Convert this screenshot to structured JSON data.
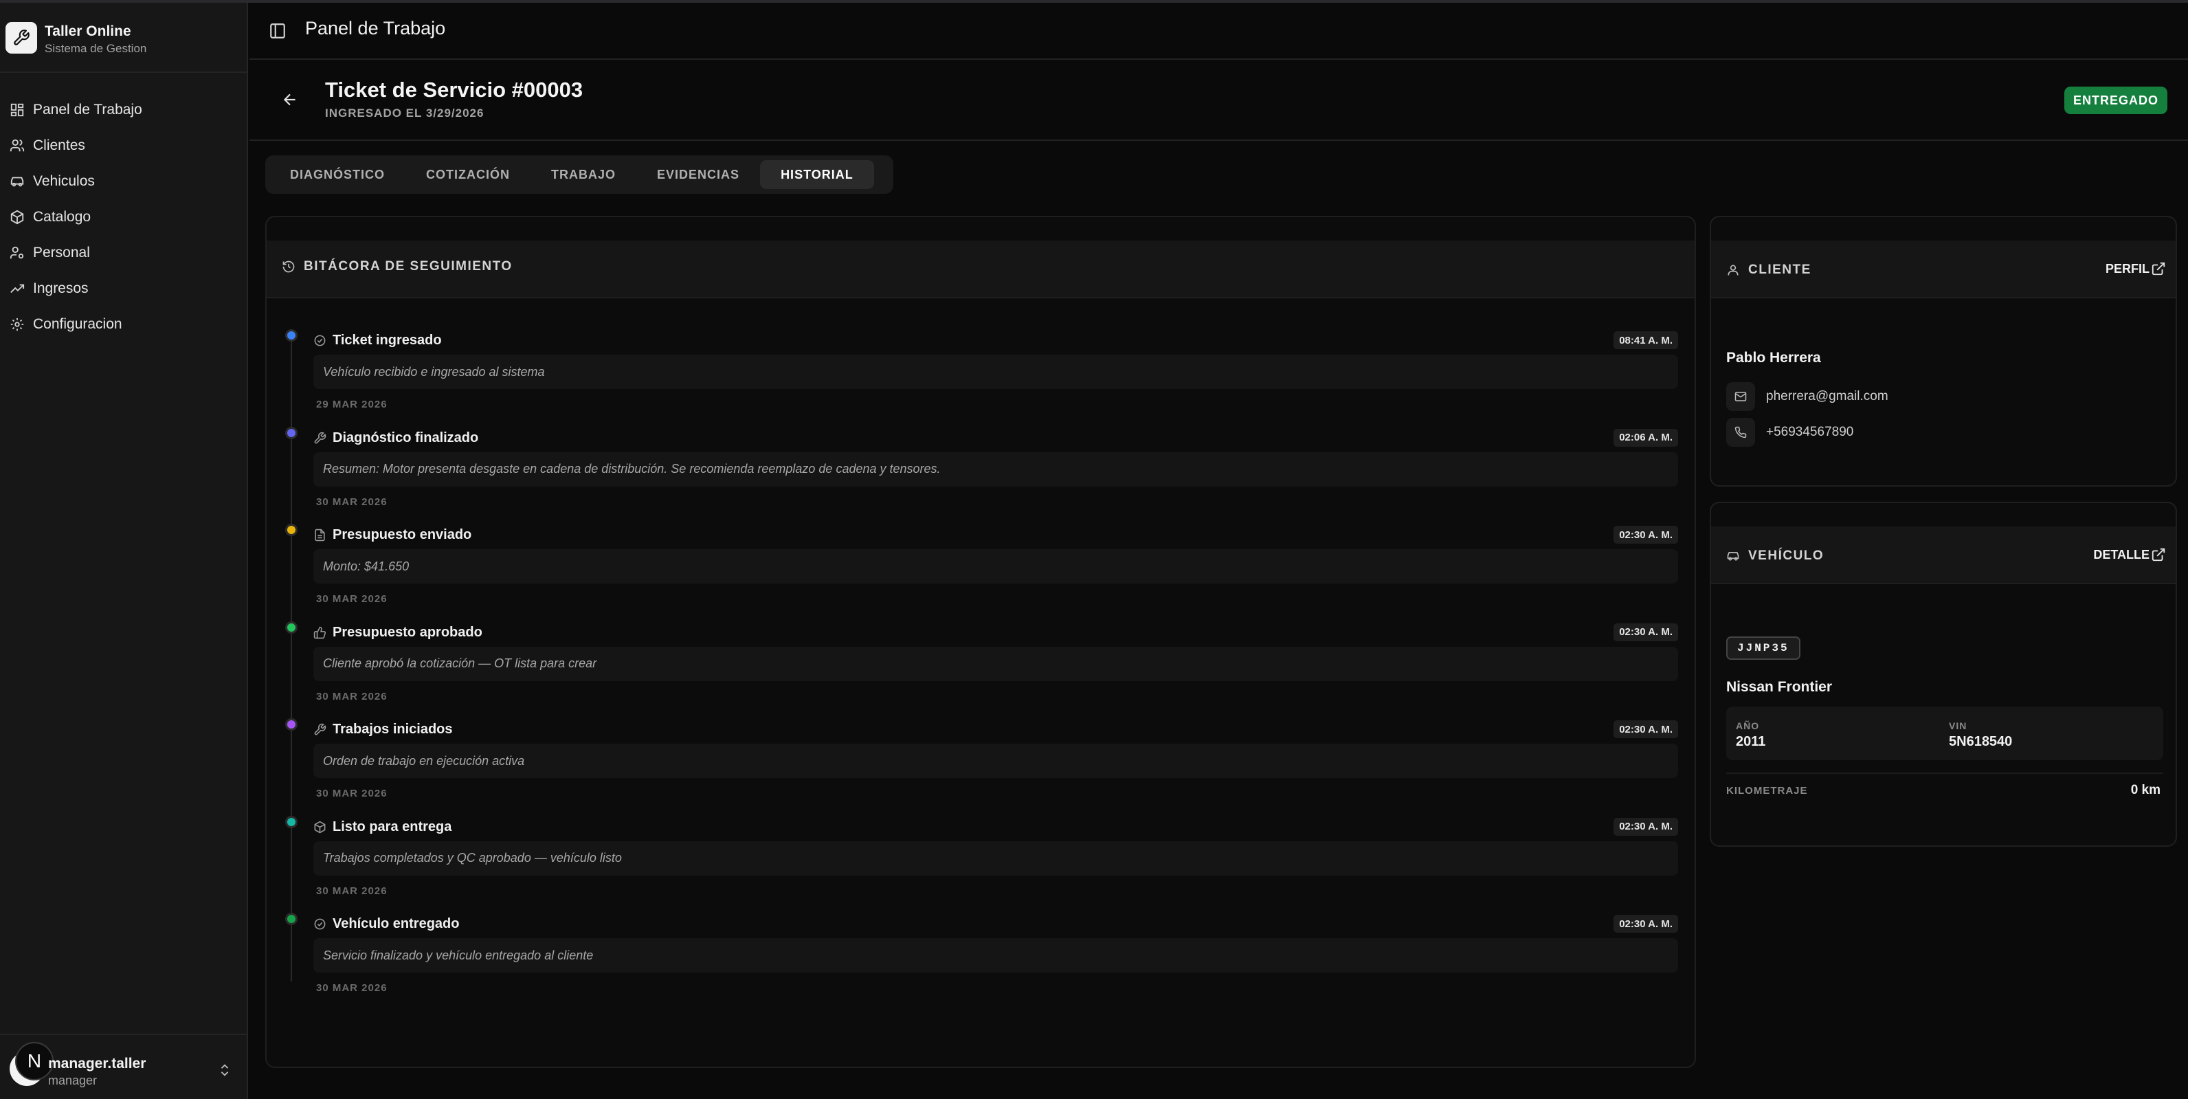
{
  "app": {
    "title": "Taller Online",
    "subtitle": "Sistema de Gestion"
  },
  "sidebar": {
    "items": [
      {
        "label": "Panel de Trabajo",
        "icon": "dashboard-icon"
      },
      {
        "label": "Clientes",
        "icon": "users-icon"
      },
      {
        "label": "Vehiculos",
        "icon": "car-icon"
      },
      {
        "label": "Catalogo",
        "icon": "package-icon"
      },
      {
        "label": "Personal",
        "icon": "user-cog-icon"
      },
      {
        "label": "Ingresos",
        "icon": "trending-up-icon"
      },
      {
        "label": "Configuracion",
        "icon": "gear-icon"
      }
    ]
  },
  "user": {
    "avatar_letter": "N",
    "name": "manager.taller",
    "role": "manager"
  },
  "header": {
    "title": "Panel de Trabajo"
  },
  "ticket": {
    "title": "Ticket de Servicio #00003",
    "subtitle": "INGRESADO EL 3/29/2026",
    "status": "ENTREGADO",
    "status_color": "#15803d"
  },
  "tabs": [
    {
      "label": "DIAGNÓSTICO",
      "active": false
    },
    {
      "label": "COTIZACIÓN",
      "active": false
    },
    {
      "label": "TRABAJO",
      "active": false
    },
    {
      "label": "EVIDENCIAS",
      "active": false
    },
    {
      "label": "HISTORIAL",
      "active": true
    }
  ],
  "log": {
    "title": "BITÁCORA DE SEGUIMIENTO",
    "events": [
      {
        "title": "Ticket ingresado",
        "time": "08:41 A. M.",
        "desc": "Vehículo recibido e ingresado al sistema",
        "date": "29 MAR 2026",
        "dot_color": "#3b82f6",
        "icon": "check-circle-icon"
      },
      {
        "title": "Diagnóstico finalizado",
        "time": "02:06 A. M.",
        "desc": "Resumen: Motor presenta desgaste en cadena de distribución. Se recomienda reemplazo de cadena y tensores.",
        "date": "30 MAR 2026",
        "dot_color": "#6366f1",
        "icon": "wrench-icon"
      },
      {
        "title": "Presupuesto enviado",
        "time": "02:30 A. M.",
        "desc": "Monto: $41.650",
        "date": "30 MAR 2026",
        "dot_color": "#eab308",
        "icon": "document-icon"
      },
      {
        "title": "Presupuesto aprobado",
        "time": "02:30 A. M.",
        "desc": "Cliente aprobó la cotización — OT lista para crear",
        "date": "30 MAR 2026",
        "dot_color": "#22c55e",
        "icon": "thumbs-up-icon"
      },
      {
        "title": "Trabajos iniciados",
        "time": "02:30 A. M.",
        "desc": "Orden de trabajo en ejecución activa",
        "date": "30 MAR 2026",
        "dot_color": "#a855f7",
        "icon": "wrench-icon"
      },
      {
        "title": "Listo para entrega",
        "time": "02:30 A. M.",
        "desc": "Trabajos completados y QC aprobado — vehículo listo",
        "date": "30 MAR 2026",
        "dot_color": "#14b8a6",
        "icon": "package-icon"
      },
      {
        "title": "Vehículo entregado",
        "time": "02:30 A. M.",
        "desc": "Servicio finalizado y vehículo entregado al cliente",
        "date": "30 MAR 2026",
        "dot_color": "#16a34a",
        "icon": "check-circle-icon"
      }
    ]
  },
  "client": {
    "section": "CLIENTE",
    "link": "PERFIL",
    "name": "Pablo Herrera",
    "email": "pherrera@gmail.com",
    "phone": "+56934567890"
  },
  "vehicle": {
    "section": "VEHÍCULO",
    "link": "DETALLE",
    "plate": "JJNP35",
    "name": "Nissan Frontier",
    "year_label": "AÑO",
    "year": "2011",
    "vin_label": "VIN",
    "vin": "5N618540",
    "km_label": "KILOMETRAJE",
    "km": "0 km"
  }
}
